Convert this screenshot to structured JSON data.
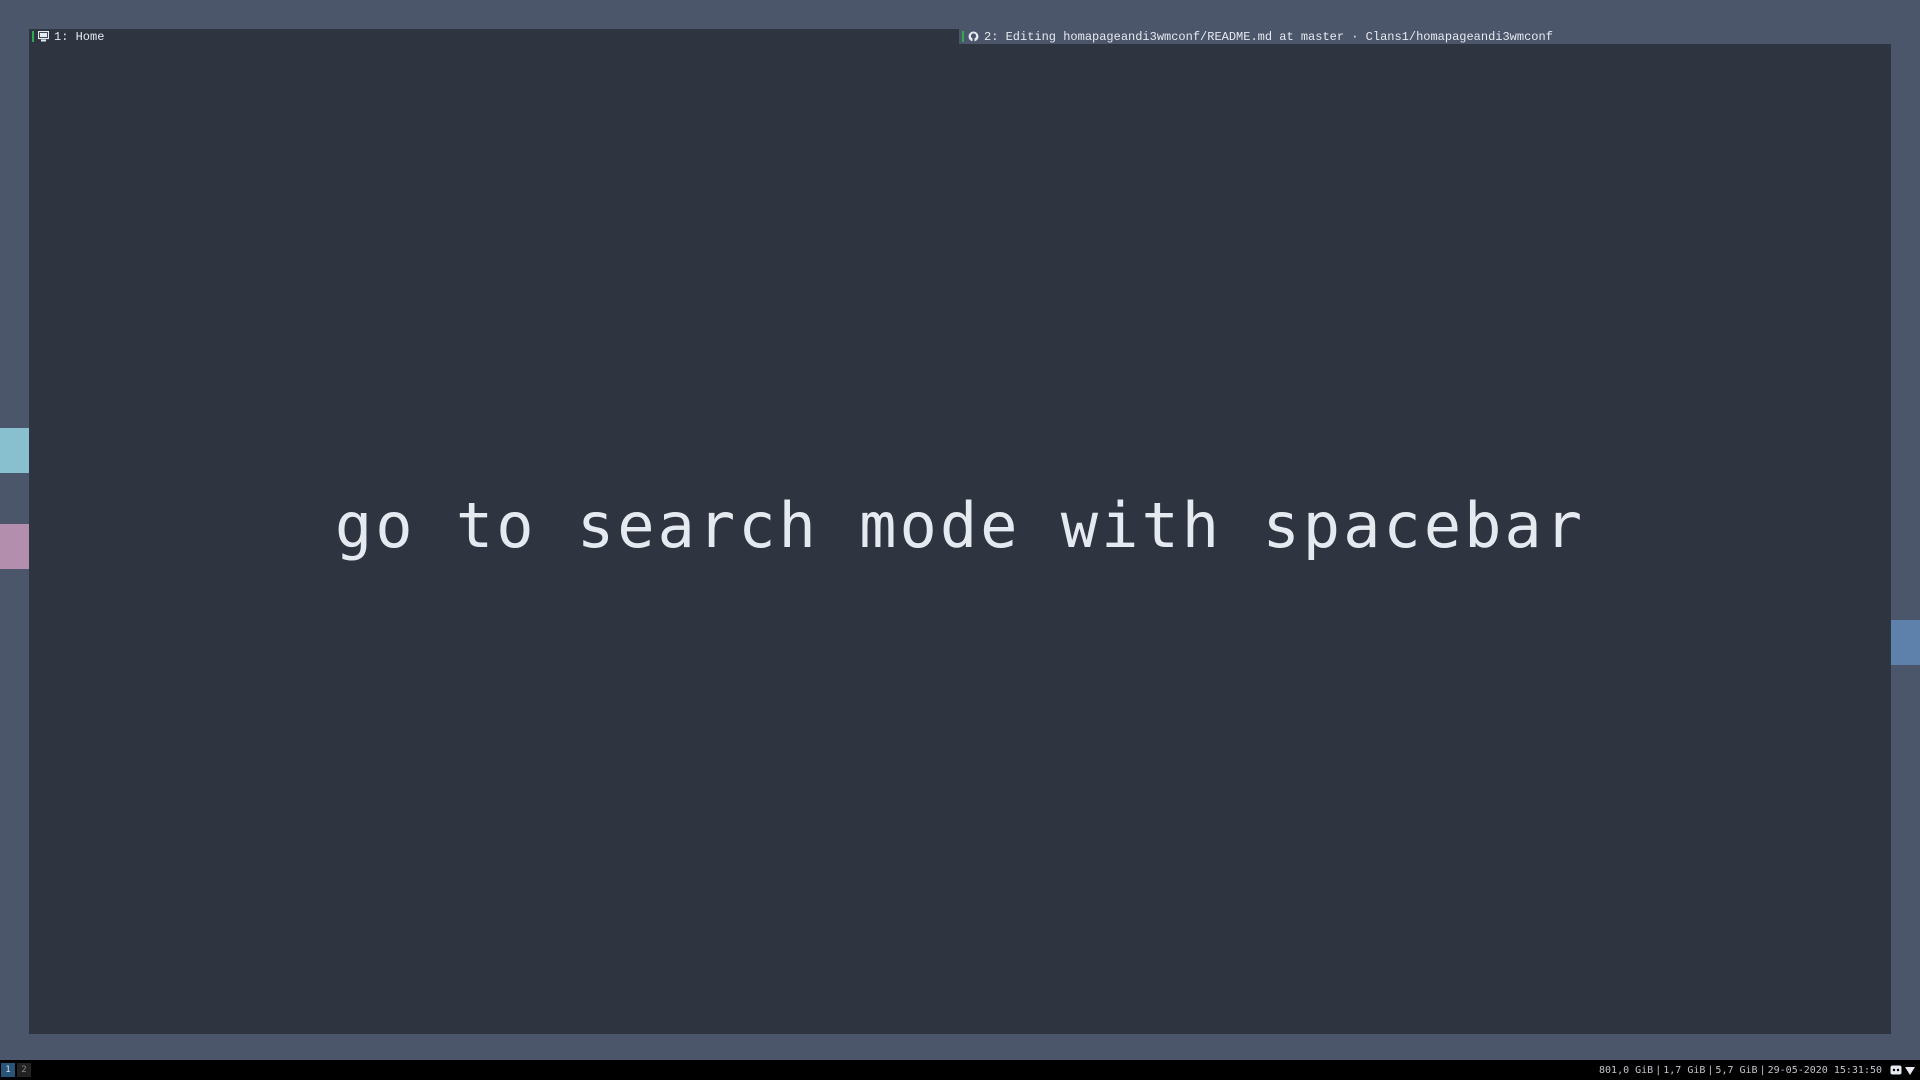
{
  "windows": [
    {
      "label": "1: Home",
      "icon": "terminal-icon"
    },
    {
      "label": "2: Editing homapageandi3wmconf/README.md at master · Clans1/homapageandi3wmconf",
      "icon": "github-icon"
    }
  ],
  "content": {
    "hint": "go to search mode with spacebar"
  },
  "bar": {
    "workspaces": [
      "1",
      "2"
    ],
    "status": {
      "disk": "801,0 GiB",
      "memory_used": "1,7 GiB",
      "memory_free": "5,7 GiB",
      "datetime": "29-05-2020 15:31:50"
    },
    "tray_icons": [
      "discord-icon",
      "network-icon"
    ]
  },
  "colors": {
    "background": "#4c566a",
    "window": "#2e3440",
    "text": "#e5e9f0",
    "scratch_cyan": "#88c0d0",
    "scratch_pink": "#b48ead",
    "scratch_blue": "#5e81ac",
    "workspace_active": "#285577",
    "bar": "#000000"
  }
}
